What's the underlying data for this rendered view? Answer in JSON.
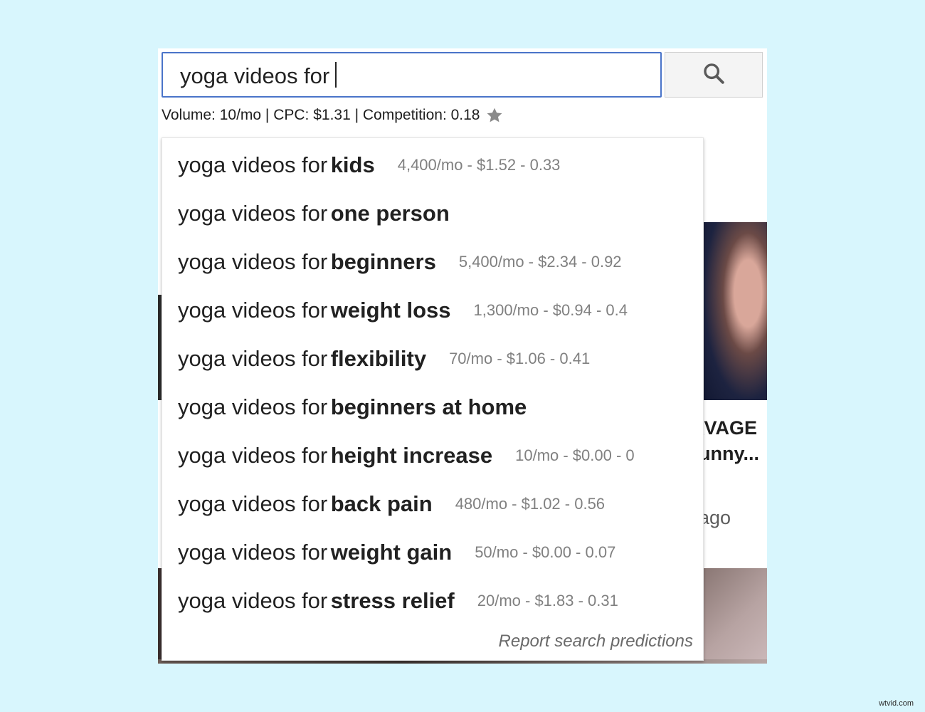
{
  "search": {
    "query": "yoga videos for",
    "button_icon": "search-icon"
  },
  "keyword_stats": {
    "text": "Volume: 10/mo | CPC: $1.31 | Competition: 0.18",
    "icon": "star-icon"
  },
  "suggestions": [
    {
      "prefix": "yoga videos for ",
      "completion": "kids",
      "metrics": "4,400/mo - $1.52 - 0.33"
    },
    {
      "prefix": "yoga videos for ",
      "completion": "one person",
      "metrics": ""
    },
    {
      "prefix": "yoga videos for ",
      "completion": "beginners",
      "metrics": "5,400/mo - $2.34 - 0.92"
    },
    {
      "prefix": "yoga videos for ",
      "completion": "weight loss",
      "metrics": "1,300/mo - $0.94 - 0.4"
    },
    {
      "prefix": "yoga videos for ",
      "completion": "flexibility",
      "metrics": "70/mo - $1.06 - 0.41"
    },
    {
      "prefix": "yoga videos for ",
      "completion": "beginners at home",
      "metrics": ""
    },
    {
      "prefix": "yoga videos for ",
      "completion": "height increase",
      "metrics": "10/mo - $0.00 - 0"
    },
    {
      "prefix": "yoga videos for ",
      "completion": "back pain",
      "metrics": "480/mo - $1.02 - 0.56"
    },
    {
      "prefix": "yoga videos for ",
      "completion": "weight gain",
      "metrics": "50/mo - $0.00 - 0.07"
    },
    {
      "prefix": "yoga videos for ",
      "completion": "stress relief",
      "metrics": "20/mo - $1.83 - 0.31"
    }
  ],
  "report_link": "Report search predictions",
  "background": {
    "title_line1": "\\VAGE",
    "title_line2": "unny...",
    "meta": "ago"
  },
  "watermark": "wtvid.com",
  "colors": {
    "page_bg": "#d8f6fd",
    "input_border": "#4a74c9",
    "metrics_text": "#808080"
  }
}
